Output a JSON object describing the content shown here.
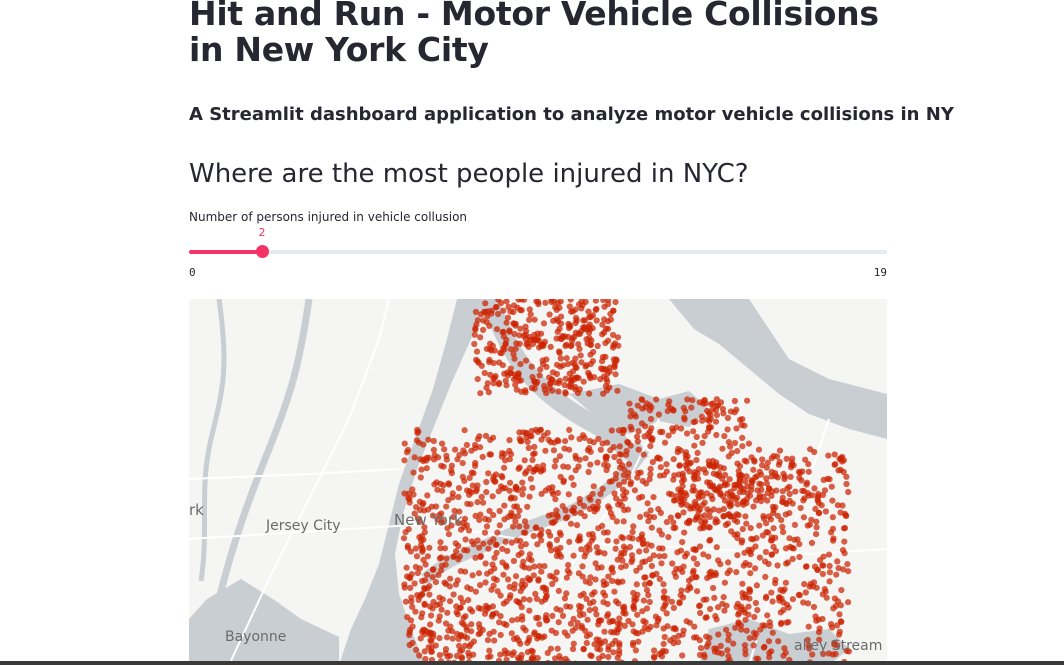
{
  "header": {
    "title": "Hit and Run - Motor Vehicle Collisions in New York City",
    "subtitle": "A Streamlit dashboard application to analyze motor vehicle collisions in NY"
  },
  "section": {
    "heading": "Where are the most people injured in NYC?"
  },
  "slider": {
    "label": "Number of persons injured in vehicle collusion",
    "value": 2,
    "min": 0,
    "max": 19,
    "value_text": "2",
    "min_text": "0",
    "max_text": "19",
    "accent_color": "#f63366"
  },
  "map": {
    "place_labels": {
      "partial_west": "rk",
      "jersey_city": "Jersey City",
      "new_york": "New York",
      "bayonne": "Bayonne",
      "valley_stream": "alley Stream"
    },
    "point_color": "#cc2200",
    "water_color": "#c9ced2",
    "land_color": "#f5f5f4"
  }
}
